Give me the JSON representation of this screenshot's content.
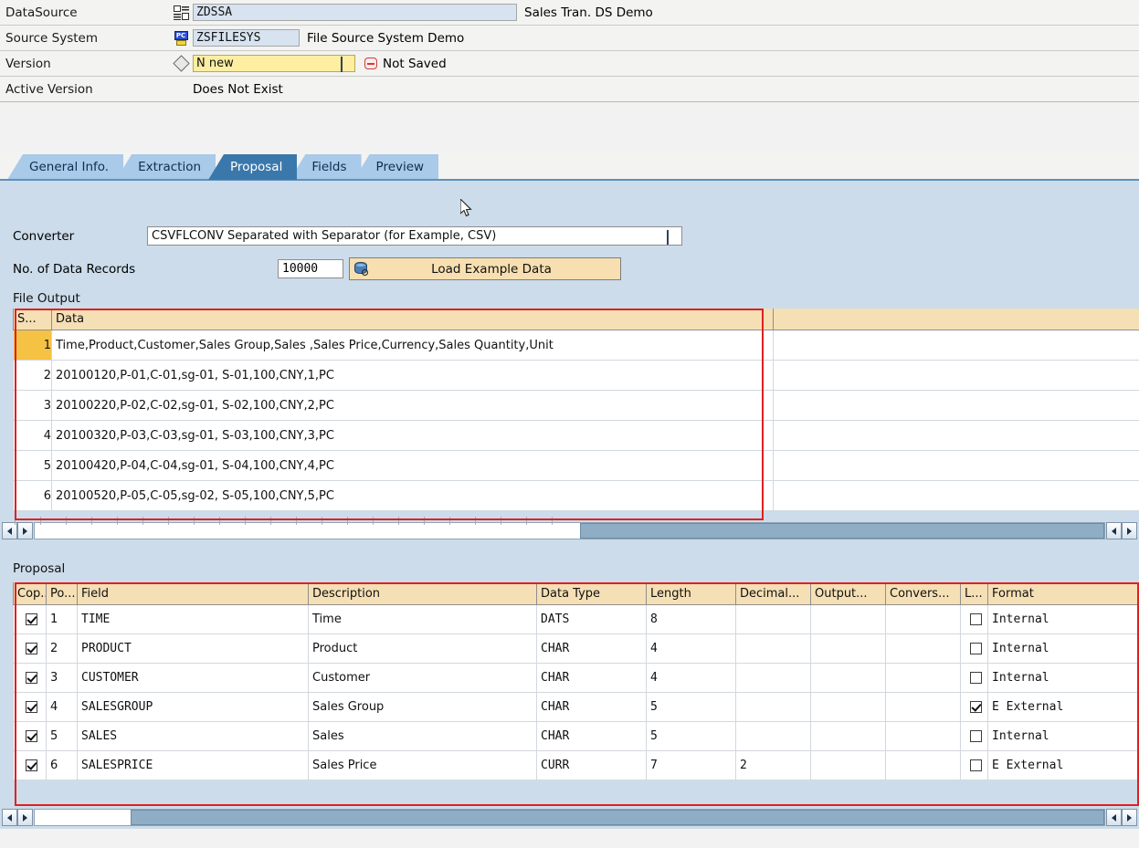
{
  "header": {
    "rows": [
      {
        "label": "DataSource",
        "icon": "datasource-icon",
        "value": "ZDSSA",
        "description": "Sales Tran. DS Demo"
      },
      {
        "label": "Source System",
        "icon": "source-system-icon",
        "value": "ZSFILESYS",
        "description": "File Source System Demo"
      },
      {
        "label": "Version",
        "icon": "diamond-icon",
        "value": "N new",
        "status": "Not Saved",
        "status_icon": "not-saved-icon"
      },
      {
        "label": "Active Version",
        "value": "Does Not Exist"
      }
    ]
  },
  "tabs": [
    {
      "label": "General Info.",
      "selected": false
    },
    {
      "label": "Extraction",
      "selected": false
    },
    {
      "label": "Proposal",
      "selected": true
    },
    {
      "label": "Fields",
      "selected": false
    },
    {
      "label": "Preview",
      "selected": false
    }
  ],
  "converter": {
    "label": "Converter",
    "value": "CSVFLCONV Separated with Separator (for Example, CSV)",
    "dropdown_icon": "dropdown-list-icon"
  },
  "records": {
    "label": "No. of Data Records",
    "value": "10000",
    "button_label": "Load Example Data",
    "button_icon": "database-load-icon"
  },
  "file_output": {
    "section_label": "File Output",
    "columns": [
      "S...",
      "Data"
    ],
    "rows": [
      {
        "n": "1",
        "highlight": true,
        "data": "Time,Product,Customer,Sales Group,Sales ,Sales Price,Currency,Sales Quantity,Unit"
      },
      {
        "n": "2",
        "highlight": false,
        "data": "20100120,P-01,C-01,sg-01, S-01,100,CNY,1,PC"
      },
      {
        "n": "3",
        "highlight": false,
        "data": "20100220,P-02,C-02,sg-01, S-02,100,CNY,2,PC"
      },
      {
        "n": "4",
        "highlight": false,
        "data": "20100320,P-03,C-03,sg-01, S-03,100,CNY,3,PC"
      },
      {
        "n": "5",
        "highlight": false,
        "data": "20100420,P-04,C-04,sg-01, S-04,100,CNY,4,PC"
      },
      {
        "n": "6",
        "highlight": false,
        "data": "20100520,P-05,C-05,sg-02, S-05,100,CNY,5,PC"
      }
    ]
  },
  "proposal": {
    "section_label": "Proposal",
    "columns": [
      "Cop...",
      "Po...",
      "Field",
      "Description",
      "Data Type",
      "Length",
      "Decimal...",
      "Output...",
      "Convers...",
      "L...",
      "Format"
    ],
    "rows": [
      {
        "copy": true,
        "pos": "1",
        "field": "TIME",
        "description": "Time",
        "data_type": "DATS",
        "length": "8",
        "decimal": "",
        "output": "",
        "conversion": "",
        "lower": false,
        "format": "Internal"
      },
      {
        "copy": true,
        "pos": "2",
        "field": "PRODUCT",
        "description": "Product",
        "data_type": "CHAR",
        "length": "4",
        "decimal": "",
        "output": "",
        "conversion": "",
        "lower": false,
        "format": "Internal"
      },
      {
        "copy": true,
        "pos": "3",
        "field": "CUSTOMER",
        "description": "Customer",
        "data_type": "CHAR",
        "length": "4",
        "decimal": "",
        "output": "",
        "conversion": "",
        "lower": false,
        "format": "Internal"
      },
      {
        "copy": true,
        "pos": "4",
        "field": "SALESGROUP",
        "description": "Sales Group",
        "data_type": "CHAR",
        "length": "5",
        "decimal": "",
        "output": "",
        "conversion": "",
        "lower": true,
        "format": "E External"
      },
      {
        "copy": true,
        "pos": "5",
        "field": "SALES",
        "description": "Sales",
        "data_type": "CHAR",
        "length": "5",
        "decimal": "",
        "output": "",
        "conversion": "",
        "lower": false,
        "format": "Internal"
      },
      {
        "copy": true,
        "pos": "6",
        "field": "SALESPRICE",
        "description": "Sales Price",
        "data_type": "CURR",
        "length": "7",
        "decimal": "2",
        "output": "",
        "conversion": "",
        "lower": false,
        "format": "E External"
      }
    ]
  },
  "scrollbars": {
    "file_output": {
      "left_arrow": "scroll-left-icon",
      "right_arrow": "scroll-right-icon",
      "thumb_start_pct": 51,
      "thumb_width_pct": 49
    },
    "proposal": {
      "left_arrow": "scroll-left-icon",
      "right_arrow": "scroll-right-icon",
      "thumb_start_pct": 9,
      "thumb_width_pct": 91
    }
  },
  "colors": {
    "tab_selected": "#3a78ab",
    "tab_normal": "#a9cae8",
    "panel": "#ccdcea",
    "grid_header": "#f5dfb5",
    "highlight_row": "#f6c244",
    "redbox": "#e02020",
    "field_blue": "#d7e3f0",
    "field_yellow": "#fdeea2",
    "button_orange": "#f7dfb1"
  }
}
